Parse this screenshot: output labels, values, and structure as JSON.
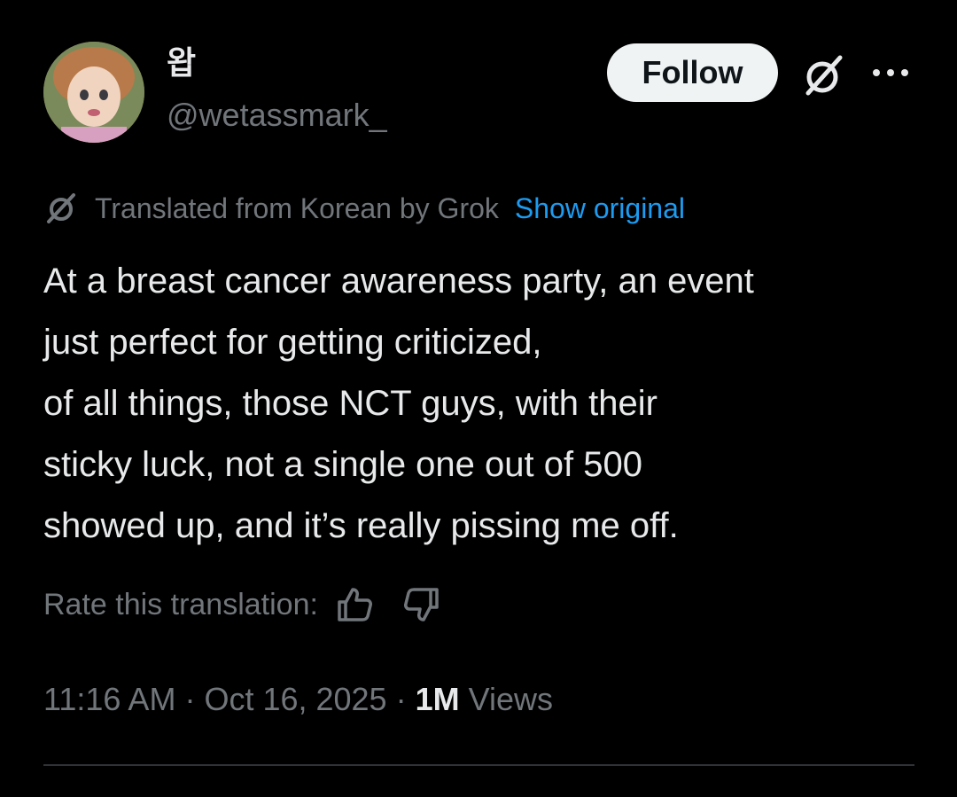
{
  "author": {
    "display_name": "왑",
    "handle": "@wetassmark_"
  },
  "actions": {
    "follow_label": "Follow",
    "grok_icon": "grok-icon",
    "more_icon": "more-icon"
  },
  "translation": {
    "label": "Translated from Korean by Grok",
    "show_original": "Show original"
  },
  "tweet": {
    "lines": [
      "At a breast cancer awareness party, an event",
      "just perfect for getting criticized,",
      "of all things, those NCT guys, with their",
      "sticky luck, not a single one out of 500",
      "showed up, and it’s really pissing me off."
    ]
  },
  "rating": {
    "label": "Rate this translation:",
    "up_icon": "thumbs-up-icon",
    "down_icon": "thumbs-down-icon"
  },
  "meta": {
    "time": "11:16 AM",
    "sep1": " · ",
    "date": "Oct 16, 2025",
    "sep2": " · ",
    "views_count": "1M",
    "views_label": " Views"
  },
  "colors": {
    "background": "#000000",
    "text": "#e7e9ea",
    "muted": "#71767b",
    "link": "#1d9bf0",
    "button_bg": "#eff3f4"
  }
}
